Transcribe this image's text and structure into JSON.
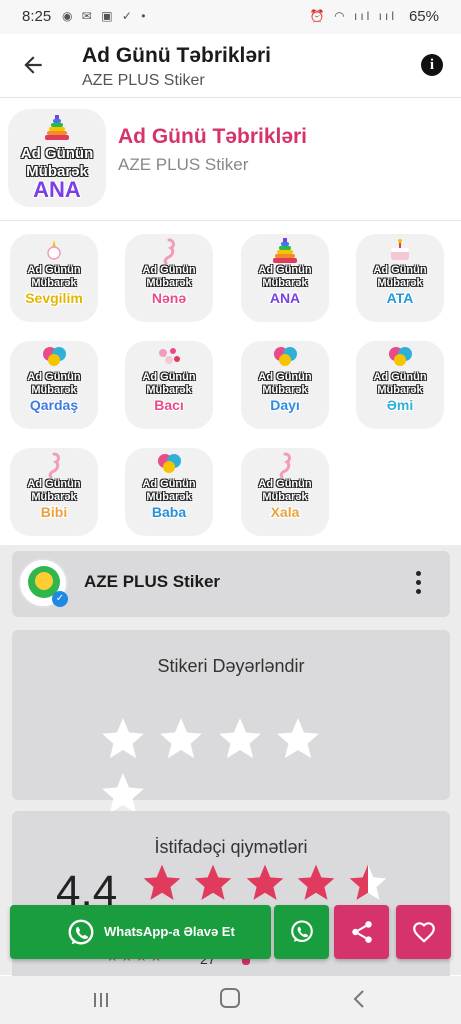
{
  "status_bar": {
    "time": "8:25",
    "battery": "65%"
  },
  "app_bar": {
    "title": "Ad Günü Təbrikləri",
    "subtitle": "AZE PLUS Stiker"
  },
  "pack": {
    "title": "Ad Günü Təbrikləri",
    "publisher": "AZE PLUS Stiker",
    "cover": {
      "line1": "Ad Günün",
      "line2": "Mübarək",
      "name": "ANA",
      "color": "#7b3fe4",
      "decor": "rainbow-stacker"
    }
  },
  "stickers": [
    {
      "line1": "Ad Günün",
      "line2": "Mübarək",
      "name": "Sevgilim",
      "color": "#e5b400",
      "decor": "unicorn"
    },
    {
      "line1": "Ad Günün",
      "line2": "Mübarək",
      "name": "Nənə",
      "color": "#e84a8a",
      "decor": "seahorse"
    },
    {
      "line1": "Ad Günün",
      "line2": "Mübarək",
      "name": "ANA",
      "color": "#7b3fe4",
      "decor": "rainbow-stacker"
    },
    {
      "line1": "Ad Günün",
      "line2": "Mübarək",
      "name": "ATA",
      "color": "#1e9ad6",
      "decor": "cake"
    },
    {
      "line1": "Ad Günün",
      "line2": "Mübarək",
      "name": "Qardaş",
      "color": "#3f7ae0",
      "decor": "balloons"
    },
    {
      "line1": "Ad Günün",
      "line2": "Mübarək",
      "name": "Bacı",
      "color": "#e84a8a",
      "decor": "flowers"
    },
    {
      "line1": "Ad Günün",
      "line2": "Mübarək",
      "name": "Dayı",
      "color": "#2f8ce0",
      "decor": "balloons"
    },
    {
      "line1": "Ad Günün",
      "line2": "Mübarək",
      "name": "Əmi",
      "color": "#2fb0d9",
      "decor": "balloons"
    },
    {
      "line1": "Ad Günün",
      "line2": "Mübarək",
      "name": "Bibi",
      "color": "#e8a33d",
      "decor": "seahorse"
    },
    {
      "line1": "Ad Günün",
      "line2": "Mübarək",
      "name": "Baba",
      "color": "#2b8fd6",
      "decor": "balloons"
    },
    {
      "line1": "Ad Günün",
      "line2": "Mübarək",
      "name": "Xala",
      "color": "#e8a33d",
      "decor": "seahorse"
    }
  ],
  "author": {
    "name": "AZE PLUS Stiker"
  },
  "rate_section": {
    "title": "Stikeri Dəyərləndir",
    "stars": 0
  },
  "user_ratings": {
    "title": "İstifadəçi qiymətləri",
    "score": "4.4",
    "stars": 4.4,
    "count": "27"
  },
  "actions": {
    "add_label": "WhatsApp-a Əlavə Et"
  },
  "colors": {
    "accent": "#d6336c",
    "whatsapp": "#1a9d3f"
  }
}
